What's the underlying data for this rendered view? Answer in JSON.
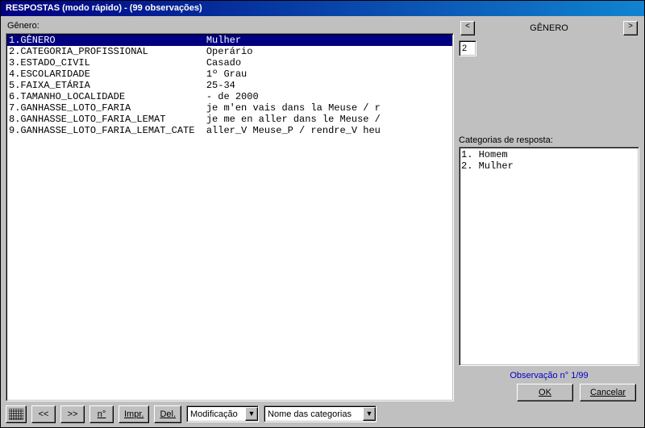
{
  "titlebar": "RESPOSTAS (modo rápido) -  (99 observações)",
  "field_label": "Gênero:",
  "rows": [
    {
      "num": "1",
      "name": "GÊNERO",
      "value": "Mulher",
      "selected": true
    },
    {
      "num": "2",
      "name": "CATEGORIA_PROFISSIONAL",
      "value": "Operário",
      "selected": false
    },
    {
      "num": "3",
      "name": "ESTADO_CIVIL",
      "value": "Casado",
      "selected": false
    },
    {
      "num": "4",
      "name": "ESCOLARIDADE",
      "value": "1º Grau",
      "selected": false
    },
    {
      "num": "5",
      "name": "FAIXA_ETÁRIA",
      "value": "25-34",
      "selected": false
    },
    {
      "num": "6",
      "name": "TAMANHO_LOCALIDADE",
      "value": "- de 2000",
      "selected": false
    },
    {
      "num": "7",
      "name": "GANHASSE_LOTO_FARIA",
      "value": "je m'en vais dans la Meuse / r",
      "selected": false
    },
    {
      "num": "8",
      "name": "GANHASSE_LOTO_FARIA_LEMAT",
      "value": "je me en aller dans le Meuse /",
      "selected": false
    },
    {
      "num": "9",
      "name": "GANHASSE_LOTO_FARIA_LEMAT_CATEG",
      "value": "aller_V Meuse_P / rendre_V heu",
      "selected": false
    }
  ],
  "right": {
    "prev": "<",
    "next": ">",
    "var_name": "GÊNERO",
    "input_value": "2",
    "categories_label": "Categorias de resposta:",
    "categories": [
      "1. Homem",
      "2. Mulher"
    ],
    "obs_label": "Observação n° 1/99"
  },
  "buttons": {
    "ok": "OK",
    "cancel": "Cancelar"
  },
  "toolbar": {
    "first": "<<",
    "last": ">>",
    "n": "n°",
    "impr": "Impr.",
    "del": "Del.",
    "combo1": "Modificação",
    "combo2": "Nome das categorias"
  }
}
